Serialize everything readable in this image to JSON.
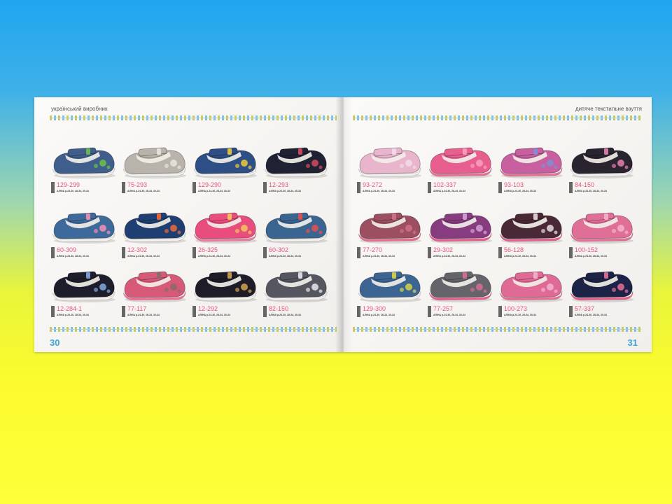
{
  "header": {
    "left": "український виробник",
    "right": "дитяче текстильне взуття"
  },
  "pages": {
    "left": "30",
    "right": "31"
  },
  "size_text": "АЛІНА р.24-30, 28-34, 30-34",
  "products": [
    {
      "code": "129-299",
      "upper": "#3f5e8c",
      "pattern": "#6fbf4a",
      "sole": "#f4f3ef"
    },
    {
      "code": "75-293",
      "upper": "#b9b4ab",
      "pattern": "#e9e4dc",
      "sole": "#f4f3ef"
    },
    {
      "code": "129-290",
      "upper": "#2d4f86",
      "pattern": "#f0c93b",
      "sole": "#f4f3ef"
    },
    {
      "code": "12-293",
      "upper": "#202234",
      "pattern": "#d44a5d",
      "sole": "#f4f3ef"
    },
    {
      "code": "60-309",
      "upper": "#3d6a9b",
      "pattern": "#f48fb1",
      "sole": "#f4f3ef"
    },
    {
      "code": "12-302",
      "upper": "#1f3f73",
      "pattern": "#ef6a3a",
      "sole": "#f4f3ef"
    },
    {
      "code": "26-325",
      "upper": "#e84d7d",
      "pattern": "#f6c55a",
      "sole": "#f27aa2"
    },
    {
      "code": "60-302",
      "upper": "#3a6591",
      "pattern": "#e45050",
      "sole": "#f4f3ef"
    },
    {
      "code": "12-284-1",
      "upper": "#1e1d2b",
      "pattern": "#7fa9e0",
      "sole": "#f4f3ef"
    },
    {
      "code": "77-117",
      "upper": "#d65a78",
      "pattern": "#8a6a6a",
      "sole": "#f36f99"
    },
    {
      "code": "12-292",
      "upper": "#1d1c28",
      "pattern": "#d2a24f",
      "sole": "#f4f3ef"
    },
    {
      "code": "82-150",
      "upper": "#55565f",
      "pattern": "#e7e7ea",
      "sole": "#f4f3ef"
    },
    {
      "code": "93-272",
      "upper": "#e8b5cc",
      "pattern": "#f2dbe8",
      "sole": "#f4f3ef"
    },
    {
      "code": "102-337",
      "upper": "#e85e8e",
      "pattern": "#f6a1c0",
      "sole": "#ee6e97"
    },
    {
      "code": "93-103",
      "upper": "#c75fa0",
      "pattern": "#7f8ed3",
      "sole": "#ee6e97"
    },
    {
      "code": "84-150",
      "upper": "#2a2330",
      "pattern": "#e97eaf",
      "sole": "#f4f3ef"
    },
    {
      "code": "77-270",
      "upper": "#9c4f60",
      "pattern": "#d07087",
      "sole": "#ec6b8f"
    },
    {
      "code": "29-302",
      "upper": "#873c7f",
      "pattern": "#d6a0d8",
      "sole": "#ea5f90"
    },
    {
      "code": "56-128",
      "upper": "#4a2936",
      "pattern": "#e7dbe0",
      "sole": "#ea5f90"
    },
    {
      "code": "100-152",
      "upper": "#e06f98",
      "pattern": "#f5b2cb",
      "sole": "#ee6e97"
    },
    {
      "code": "129-300",
      "upper": "#3c6594",
      "pattern": "#d5d445",
      "sole": "#f4f3ef"
    },
    {
      "code": "77-257",
      "upper": "#64646a",
      "pattern": "#d96b94",
      "sole": "#ea5f90"
    },
    {
      "code": "100-273",
      "upper": "#e06a96",
      "pattern": "#f3b3cc",
      "sole": "#ee6e97"
    },
    {
      "code": "57-337",
      "upper": "#1d2346",
      "pattern": "#e66f9b",
      "sole": "#ea5f90"
    }
  ]
}
